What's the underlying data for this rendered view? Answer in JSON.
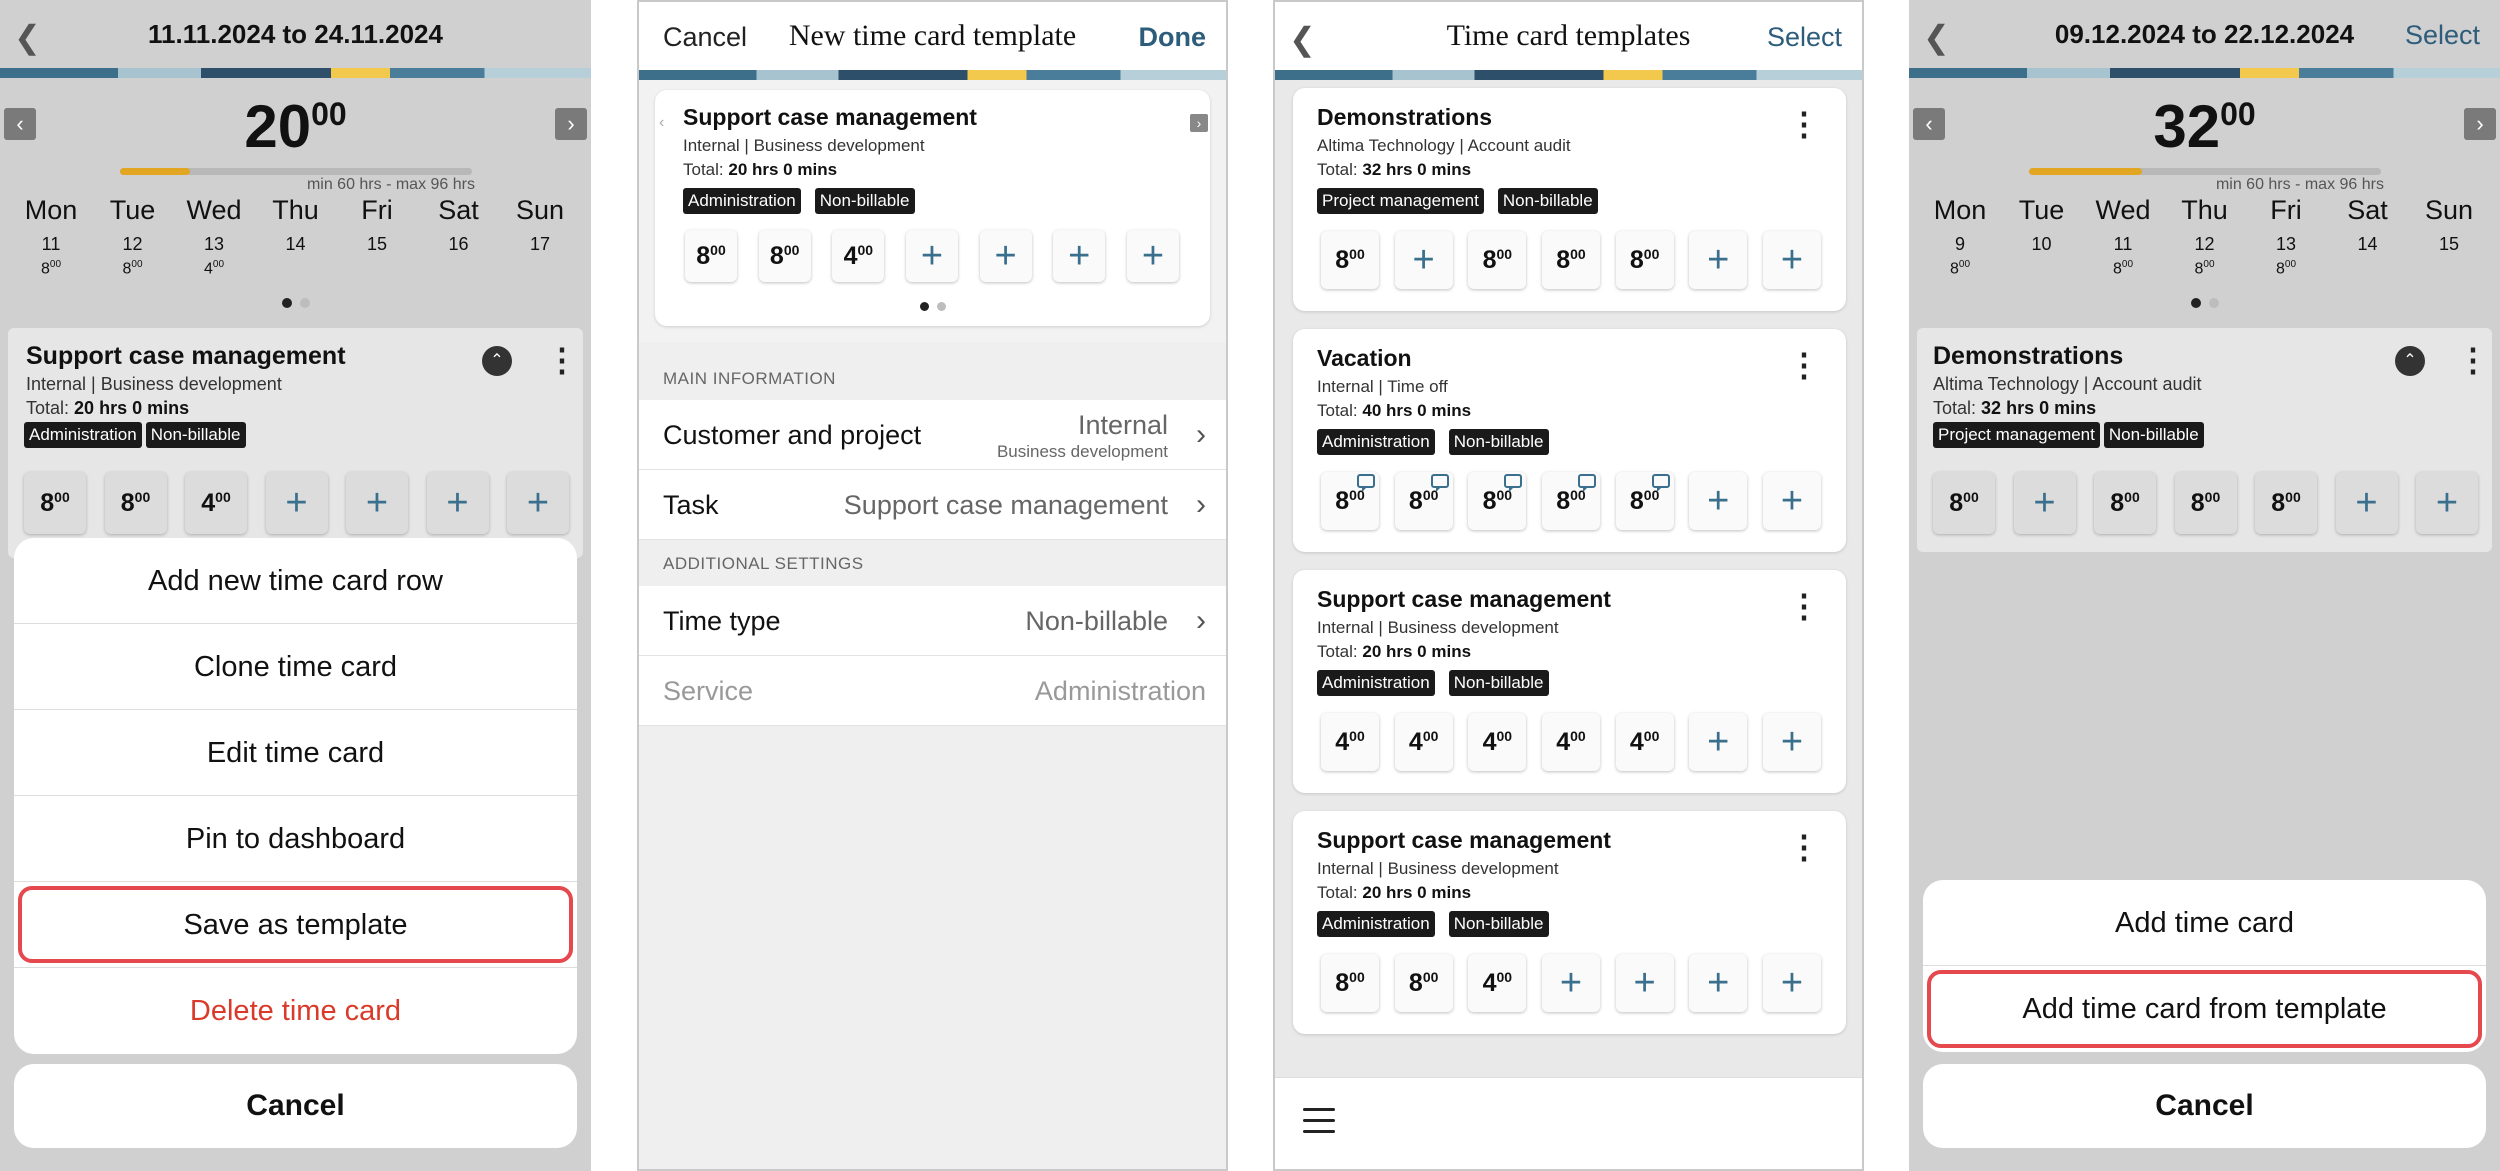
{
  "panel1": {
    "date_range": "11.11.2024 to 24.11.2024",
    "total_hours": "20",
    "total_minutes": "00",
    "min_max": "min 60 hrs - max 96 hrs",
    "days": [
      {
        "name": "Mon",
        "date": "11",
        "h": "8",
        "m": "00"
      },
      {
        "name": "Tue",
        "date": "12",
        "h": "8",
        "m": "00"
      },
      {
        "name": "Wed",
        "date": "13",
        "h": "4",
        "m": "00"
      },
      {
        "name": "Thu",
        "date": "14",
        "h": "",
        "m": ""
      },
      {
        "name": "Fri",
        "date": "15",
        "h": "",
        "m": ""
      },
      {
        "name": "Sat",
        "date": "16",
        "h": "",
        "m": ""
      },
      {
        "name": "Sun",
        "date": "17",
        "h": "",
        "m": ""
      }
    ],
    "progress": 0.2,
    "card": {
      "title": "Support case management",
      "subtitle": "Internal | Business development",
      "total_label": "Total:",
      "total_value": "20 hrs 0 mins",
      "tags": [
        "Administration",
        "Non-billable"
      ],
      "cells": [
        "8",
        "8",
        "4",
        "+",
        "+",
        "+",
        "+"
      ]
    },
    "menu": [
      "Add new time card row",
      "Clone time card",
      "Edit time card",
      "Pin to dashboard",
      "Save as template",
      "Delete time card"
    ],
    "cancel": "Cancel"
  },
  "panel2": {
    "cancel": "Cancel",
    "title": "New time card template",
    "done": "Done",
    "card": {
      "title": "Support case management",
      "subtitle": "Internal | Business development",
      "total_label": "Total:",
      "total_value": "20 hrs 0 mins",
      "tags": [
        "Administration",
        "Non-billable"
      ],
      "cells": [
        "8",
        "8",
        "4",
        "+",
        "+",
        "+",
        "+"
      ]
    },
    "main_info": "MAIN INFORMATION",
    "customer_label": "Customer and project",
    "customer_value": "Internal",
    "customer_sub": "Business development",
    "task_label": "Task",
    "task_value": "Support case management",
    "additional": "ADDITIONAL SETTINGS",
    "timetype_label": "Time type",
    "timetype_value": "Non-billable",
    "service_label": "Service",
    "service_value": "Administration"
  },
  "panel3": {
    "title": "Time card templates",
    "select": "Select",
    "templates": [
      {
        "title": "Demonstrations",
        "subtitle": "Altima Technology | Account audit",
        "total_label": "Total:",
        "total_value": "32 hrs 0 mins",
        "tags": [
          "Project management",
          "Non-billable"
        ],
        "cells": [
          "8",
          "+",
          "8",
          "8",
          "8",
          "+",
          "+"
        ],
        "comments": false
      },
      {
        "title": "Vacation",
        "subtitle": "Internal | Time off",
        "total_label": "Total:",
        "total_value": "40 hrs 0 mins",
        "tags": [
          "Administration",
          "Non-billable"
        ],
        "cells": [
          "8",
          "8",
          "8",
          "8",
          "8",
          "+",
          "+"
        ],
        "comments": true
      },
      {
        "title": "Support case management",
        "subtitle": "Internal | Business development",
        "total_label": "Total:",
        "total_value": "20 hrs 0 mins",
        "tags": [
          "Administration",
          "Non-billable"
        ],
        "cells": [
          "4",
          "4",
          "4",
          "4",
          "4",
          "+",
          "+"
        ],
        "comments": false
      },
      {
        "title": "Support case management",
        "subtitle": "Internal | Business development",
        "total_label": "Total:",
        "total_value": "20 hrs 0 mins",
        "tags": [
          "Administration",
          "Non-billable"
        ],
        "cells": [
          "8",
          "8",
          "4",
          "+",
          "+",
          "+",
          "+"
        ],
        "comments": false
      }
    ]
  },
  "panel4": {
    "date_range": "09.12.2024 to 22.12.2024",
    "select": "Select",
    "total_hours": "32",
    "total_minutes": "00",
    "min_max": "min 60 hrs - max 96 hrs",
    "days": [
      {
        "name": "Mon",
        "date": "9",
        "h": "8",
        "m": "00"
      },
      {
        "name": "Tue",
        "date": "10",
        "h": "",
        "m": ""
      },
      {
        "name": "Wed",
        "date": "11",
        "h": "8",
        "m": "00"
      },
      {
        "name": "Thu",
        "date": "12",
        "h": "8",
        "m": "00"
      },
      {
        "name": "Fri",
        "date": "13",
        "h": "8",
        "m": "00"
      },
      {
        "name": "Sat",
        "date": "14",
        "h": "",
        "m": ""
      },
      {
        "name": "Sun",
        "date": "15",
        "h": "",
        "m": ""
      }
    ],
    "progress": 0.32,
    "card": {
      "title": "Demonstrations",
      "subtitle": "Altima Technology | Account audit",
      "total_label": "Total:",
      "total_value": "32 hrs 0 mins",
      "tags": [
        "Project management",
        "Non-billable"
      ],
      "cells": [
        "8",
        "+",
        "8",
        "8",
        "8",
        "+",
        "+"
      ]
    },
    "menu": [
      "Add time card",
      "Add time card from template"
    ],
    "cancel": "Cancel"
  },
  "minutes_sup": "00",
  "colors": {
    "accent": "#2d5d7b",
    "progress": "#e3a623",
    "danger": "#d93a2a",
    "highlight": "#e5484d"
  }
}
